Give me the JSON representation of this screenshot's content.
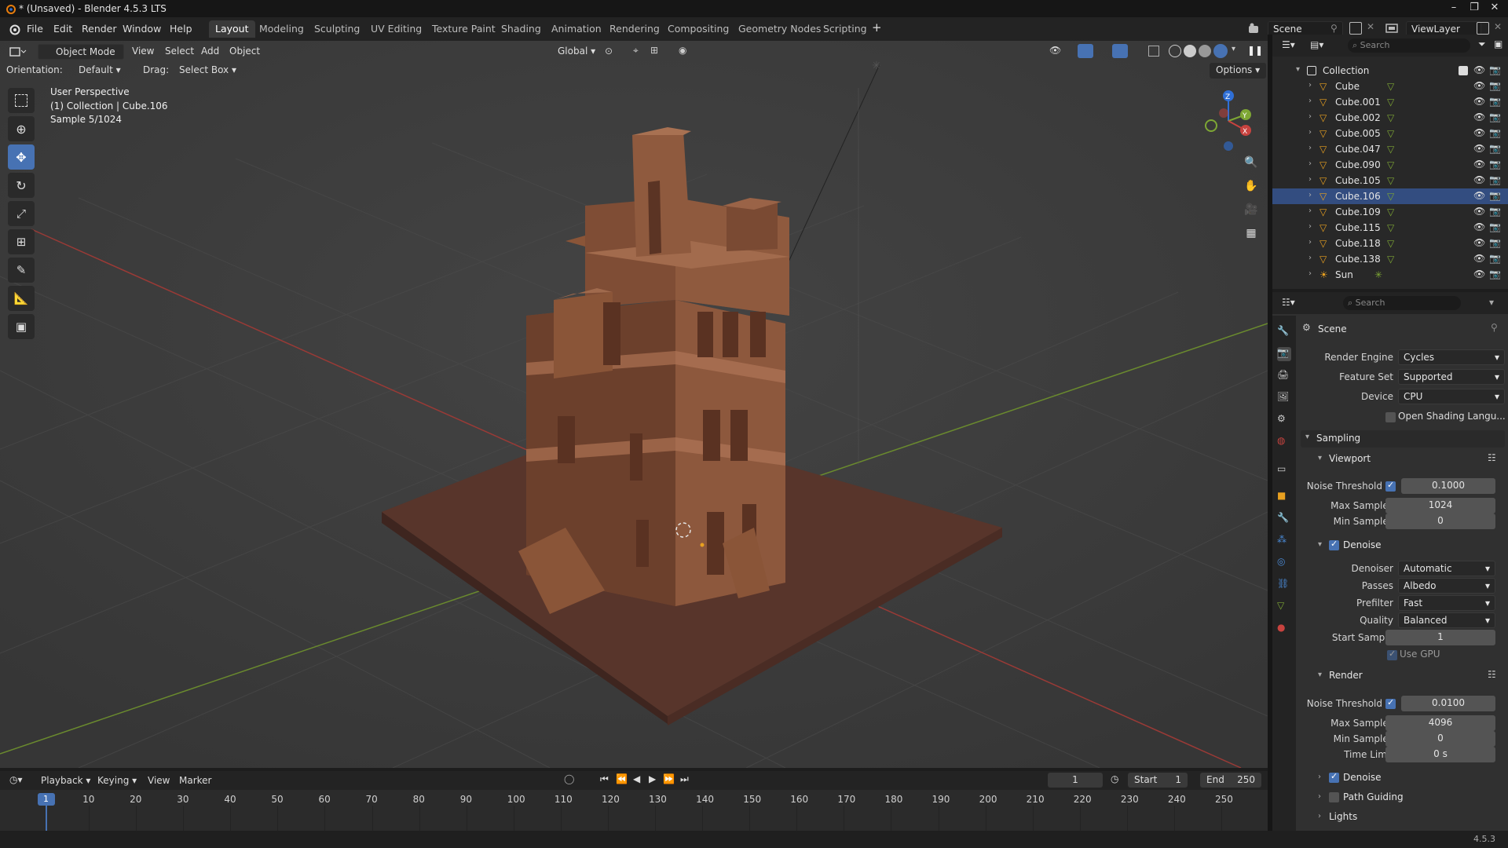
{
  "window": {
    "title": "* (Unsaved) - Blender 4.5.3 LTS",
    "controls": [
      "–",
      "❐",
      "✕"
    ]
  },
  "menu": [
    "File",
    "Edit",
    "Render",
    "Window",
    "Help"
  ],
  "workspaces": [
    "Layout",
    "Modeling",
    "Sculpting",
    "UV Editing",
    "Texture Paint",
    "Shading",
    "Animation",
    "Rendering",
    "Compositing",
    "Geometry Nodes",
    "Scripting"
  ],
  "active_workspace": "Layout",
  "scene_selector": "Scene",
  "viewlayer_selector": "ViewLayer",
  "viewport_header": {
    "mode": "Object Mode",
    "menus": [
      "View",
      "Select",
      "Add",
      "Object"
    ],
    "transform_orientation": "Global",
    "orientation_label": "Orientation:",
    "orientation_value": "Default",
    "drag_label": "Drag:",
    "drag_value": "Select Box",
    "options": "Options"
  },
  "viewport_overlay": {
    "line1": "User Perspective",
    "line2": "(1) Collection | Cube.106",
    "line3": "Sample 5/1024"
  },
  "gizmo_axes": [
    "Z",
    "Y",
    "X"
  ],
  "outliner": {
    "search_placeholder": "Search",
    "collection": "Collection",
    "objects": [
      "Cube",
      "Cube.001",
      "Cube.002",
      "Cube.005",
      "Cube.047",
      "Cube.090",
      "Cube.105",
      "Cube.106",
      "Cube.109",
      "Cube.115",
      "Cube.118",
      "Cube.138",
      "Sun"
    ]
  },
  "properties": {
    "search_placeholder": "Search",
    "context": "Scene",
    "render_engine_label": "Render Engine",
    "render_engine": "Cycles",
    "feature_set_label": "Feature Set",
    "feature_set": "Supported",
    "device_label": "Device",
    "device": "CPU",
    "osl_label": "Open Shading Langu...",
    "sampling": "Sampling",
    "viewport": {
      "title": "Viewport",
      "noise_threshold_label": "Noise Threshold",
      "noise_threshold": "0.1000",
      "max_samples_label": "Max Samples",
      "max_samples": "1024",
      "min_samples_label": "Min Samples",
      "min_samples": "0"
    },
    "denoise": {
      "title": "Denoise",
      "denoiser_label": "Denoiser",
      "denoiser": "Automatic",
      "passes_label": "Passes",
      "passes": "Albedo",
      "prefilter_label": "Prefilter",
      "prefilter": "Fast",
      "quality_label": "Quality",
      "quality": "Balanced",
      "start_sample_label": "Start Sample",
      "start_sample": "1",
      "use_gpu": "Use GPU"
    },
    "render": {
      "title": "Render",
      "noise_threshold_label": "Noise Threshold",
      "noise_threshold": "0.0100",
      "max_samples_label": "Max Samples",
      "max_samples": "4096",
      "min_samples_label": "Min Samples",
      "min_samples": "0",
      "time_limit_label": "Time Limit",
      "time_limit": "0 s"
    },
    "subpanels": [
      "Denoise",
      "Path Guiding",
      "Lights"
    ]
  },
  "timeline": {
    "menus": [
      "Playback",
      "Keying",
      "View",
      "Marker"
    ],
    "current_frame": "1",
    "start_label": "Start",
    "start": "1",
    "end_label": "End",
    "end": "250",
    "ruler": [
      "1",
      "10",
      "20",
      "30",
      "40",
      "50",
      "60",
      "70",
      "80",
      "90",
      "100",
      "110",
      "120",
      "130",
      "140",
      "150",
      "160",
      "170",
      "180",
      "190",
      "200",
      "210",
      "220",
      "230",
      "240",
      "250"
    ]
  },
  "status": {
    "version": "4.5.3"
  },
  "colors": {
    "accent": "#4772b3",
    "axis_x": "#c8433f",
    "axis_y": "#7ea734",
    "axis_z": "#2f6fd6",
    "building": "#8a5538"
  }
}
